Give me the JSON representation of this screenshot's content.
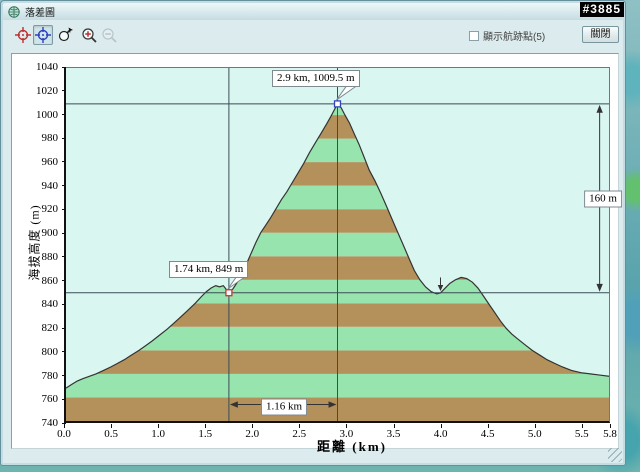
{
  "window": {
    "title": "落差圖",
    "overlay_tag": "#3885"
  },
  "toolbar": {
    "buttons": [
      {
        "name": "crosshair-red",
        "pressed": false,
        "disabled": false
      },
      {
        "name": "crosshair-blue",
        "pressed": true,
        "disabled": false
      },
      {
        "name": "zoom-select",
        "pressed": false,
        "disabled": false
      },
      {
        "name": "zoom-in",
        "pressed": false,
        "disabled": false
      },
      {
        "name": "zoom-out",
        "pressed": false,
        "disabled": true
      }
    ],
    "checkbox_label": "顯示航跡點(5)",
    "checkbox_checked": false,
    "close_label": "關閉"
  },
  "chart_data": {
    "type": "area",
    "xlabel": "距離 (km)",
    "ylabel": "海拔高度 (m)",
    "xlim": [
      0,
      5.8
    ],
    "ylim": [
      740,
      1040
    ],
    "x_tick_labels": [
      "0.0",
      "0.5",
      "1.0",
      "1.5",
      "2.0",
      "2.5",
      "3.0",
      "3.5",
      "4.0",
      "4.5",
      "5.0",
      "5.5",
      "5.8"
    ],
    "x_tick_values": [
      0,
      0.5,
      1,
      1.5,
      2,
      2.5,
      3,
      3.5,
      4,
      4.5,
      5,
      5.5,
      5.8
    ],
    "y_ticks": [
      740,
      760,
      780,
      800,
      820,
      840,
      860,
      880,
      900,
      920,
      940,
      960,
      980,
      1000,
      1020,
      1040
    ],
    "grid": false,
    "background": "#d9f6f1",
    "band_height_m": 20,
    "band_colors": [
      "#b4905a",
      "#98e4ae"
    ],
    "outline_color": "#333333",
    "crosshair_color": "#3a4d55",
    "measure_color": "#333333",
    "profile": [
      [
        0.0,
        768
      ],
      [
        0.06,
        771
      ],
      [
        0.12,
        774
      ],
      [
        0.18,
        776
      ],
      [
        0.25,
        778
      ],
      [
        0.32,
        780
      ],
      [
        0.4,
        783
      ],
      [
        0.48,
        786
      ],
      [
        0.55,
        789
      ],
      [
        0.62,
        792
      ],
      [
        0.7,
        796
      ],
      [
        0.78,
        800
      ],
      [
        0.85,
        804
      ],
      [
        0.92,
        808
      ],
      [
        1.0,
        813
      ],
      [
        1.08,
        818
      ],
      [
        1.15,
        823
      ],
      [
        1.22,
        828
      ],
      [
        1.3,
        834
      ],
      [
        1.38,
        840
      ],
      [
        1.45,
        846
      ],
      [
        1.5,
        850
      ],
      [
        1.55,
        853
      ],
      [
        1.6,
        855
      ],
      [
        1.64,
        854
      ],
      [
        1.68,
        855
      ],
      [
        1.71,
        852
      ],
      [
        1.74,
        849
      ],
      [
        1.78,
        852
      ],
      [
        1.83,
        858
      ],
      [
        1.88,
        866
      ],
      [
        1.93,
        874
      ],
      [
        1.98,
        883
      ],
      [
        2.03,
        892
      ],
      [
        2.08,
        900
      ],
      [
        2.13,
        906
      ],
      [
        2.18,
        912
      ],
      [
        2.24,
        920
      ],
      [
        2.3,
        928
      ],
      [
        2.36,
        935
      ],
      [
        2.42,
        943
      ],
      [
        2.48,
        951
      ],
      [
        2.54,
        959
      ],
      [
        2.6,
        968
      ],
      [
        2.66,
        976
      ],
      [
        2.72,
        984
      ],
      [
        2.78,
        992
      ],
      [
        2.83,
        999
      ],
      [
        2.87,
        1005
      ],
      [
        2.9,
        1009.5
      ],
      [
        2.94,
        1006
      ],
      [
        2.98,
        1000
      ],
      [
        3.03,
        993
      ],
      [
        3.08,
        984
      ],
      [
        3.13,
        975
      ],
      [
        3.18,
        965
      ],
      [
        3.24,
        953
      ],
      [
        3.3,
        944
      ],
      [
        3.36,
        934
      ],
      [
        3.42,
        923
      ],
      [
        3.48,
        912
      ],
      [
        3.54,
        901
      ],
      [
        3.6,
        890
      ],
      [
        3.66,
        879
      ],
      [
        3.72,
        868
      ],
      [
        3.78,
        860
      ],
      [
        3.84,
        854
      ],
      [
        3.9,
        850
      ],
      [
        3.96,
        848
      ],
      [
        4.0,
        849
      ],
      [
        4.05,
        853
      ],
      [
        4.1,
        857
      ],
      [
        4.16,
        860
      ],
      [
        4.22,
        862
      ],
      [
        4.28,
        861
      ],
      [
        4.34,
        858
      ],
      [
        4.4,
        853
      ],
      [
        4.46,
        846
      ],
      [
        4.52,
        839
      ],
      [
        4.58,
        832
      ],
      [
        4.64,
        825
      ],
      [
        4.7,
        819
      ],
      [
        4.76,
        814
      ],
      [
        4.82,
        810
      ],
      [
        4.9,
        805
      ],
      [
        4.98,
        800
      ],
      [
        5.06,
        796
      ],
      [
        5.14,
        792
      ],
      [
        5.22,
        789
      ],
      [
        5.3,
        786
      ],
      [
        5.4,
        783
      ],
      [
        5.5,
        781
      ],
      [
        5.6,
        780
      ],
      [
        5.7,
        779
      ],
      [
        5.8,
        778
      ]
    ],
    "annotations": [
      {
        "label": "1.74 km, 849 m",
        "x_km": 1.74,
        "y_m": 849,
        "marker_color": "#cc3333"
      },
      {
        "label": "2.9 km, 1009.5 m",
        "x_km": 2.9,
        "y_m": 1009.5,
        "marker_color": "#3344bb"
      }
    ],
    "measurements": [
      {
        "label": "1.16 km",
        "type": "horizontal",
        "from_km": 1.74,
        "to_km": 2.9,
        "at_m": 754
      },
      {
        "label": "160 m",
        "type": "vertical",
        "from_m": 849,
        "to_m": 1009.5,
        "at_km": 5.7
      }
    ],
    "dip_arrow": {
      "x_km": 4.0,
      "tail_m": 862,
      "tip_m": 850.5
    }
  }
}
